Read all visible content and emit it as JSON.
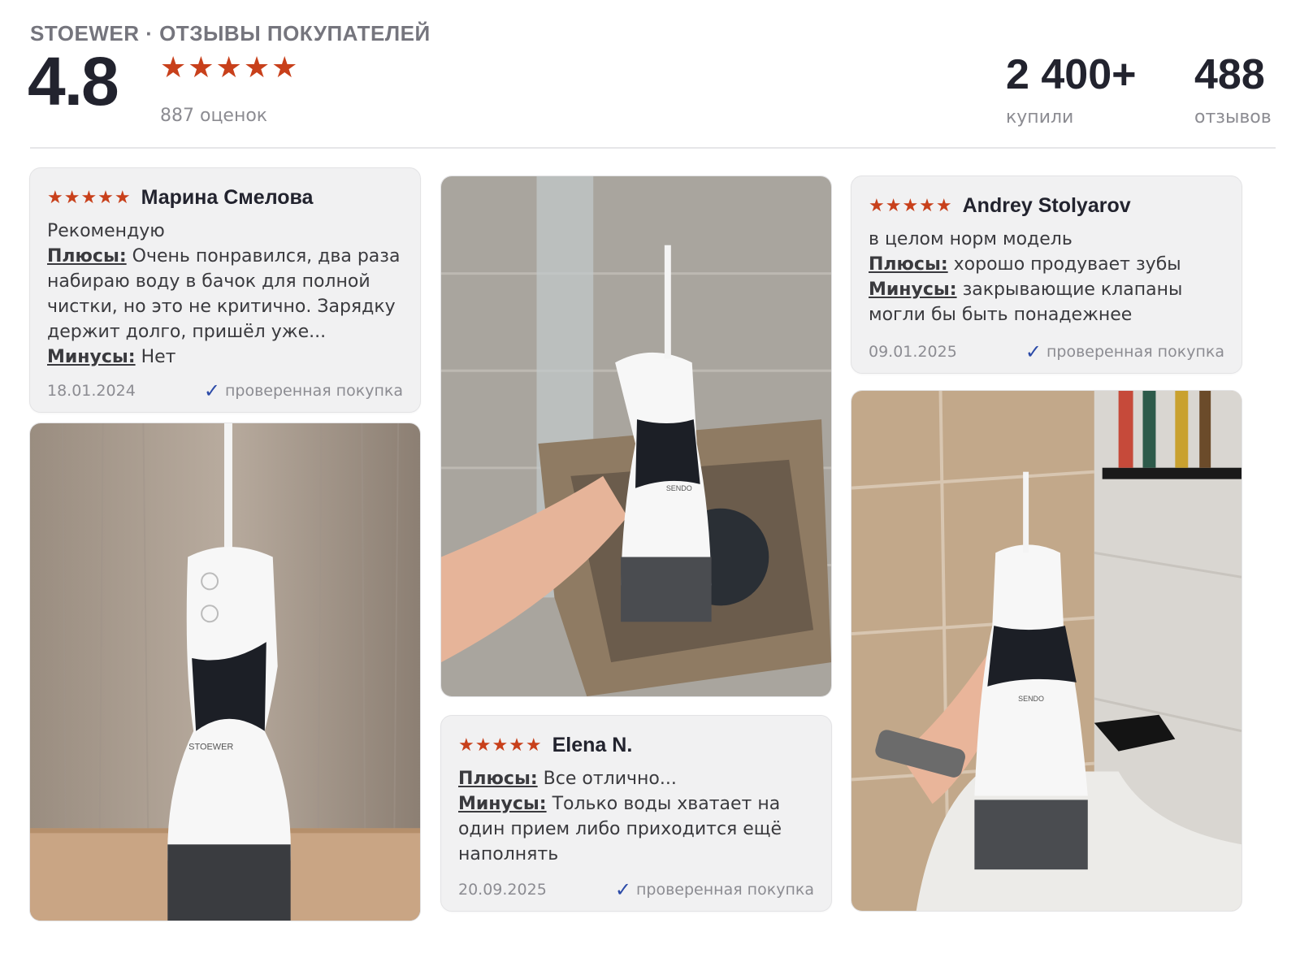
{
  "header": {
    "brand": "STOEWER · ОТЗЫВЫ ПОКУПАТЕЛЕЙ",
    "rating": "4.8",
    "stars": "★★★★★",
    "ratings_count": "887 оценок",
    "bought_value": "2 400+",
    "bought_label": "купили",
    "reviews_value": "488",
    "reviews_label": "отзывов"
  },
  "colors": {
    "star": "#c8401b",
    "check": "#2b4aa8",
    "text_dark": "#22232e",
    "muted": "#8c8c92",
    "card_bg": "#f1f1f2"
  },
  "reviews": [
    {
      "stars": "★★★★★",
      "author": "Марина Смелова",
      "title": "Рекомендую",
      "pros_label": "Плюсы:",
      "pros": "Очень понравился, два раза набираю воду в бачок для полной чистки, но это не критично. Зарядку держит долго, пришёл уже...",
      "cons_label": "Минусы:",
      "cons": "Нет",
      "date": "18.01.2024",
      "verified": "проверенная покупка",
      "check_icon": "✓"
    },
    {
      "stars": "★★★★★",
      "author": "Andrey Stolyarov",
      "title": "в целом норм модель",
      "pros_label": "Плюсы:",
      "pros": "хорошо продувает зубы",
      "cons_label": "Минусы:",
      "cons": "закрывающие клапаны могли бы быть понадежнее",
      "date": "09.01.2025",
      "verified": "проверенная покупка",
      "check_icon": "✓"
    },
    {
      "stars": "★★★★★",
      "author": "Elena N.",
      "pros_label": "Плюсы:",
      "pros": "Все отлично...",
      "cons_label": "Минусы:",
      "cons": "Только воды хватает на один прием либо приходится ещё наполнять",
      "date": "20.09.2025",
      "verified": "проверенная покупка",
      "check_icon": "✓"
    }
  ],
  "photos": {
    "photo1_label": "STOEWER",
    "photo2_label": "SENDO",
    "photo3_label": "SENDO"
  }
}
